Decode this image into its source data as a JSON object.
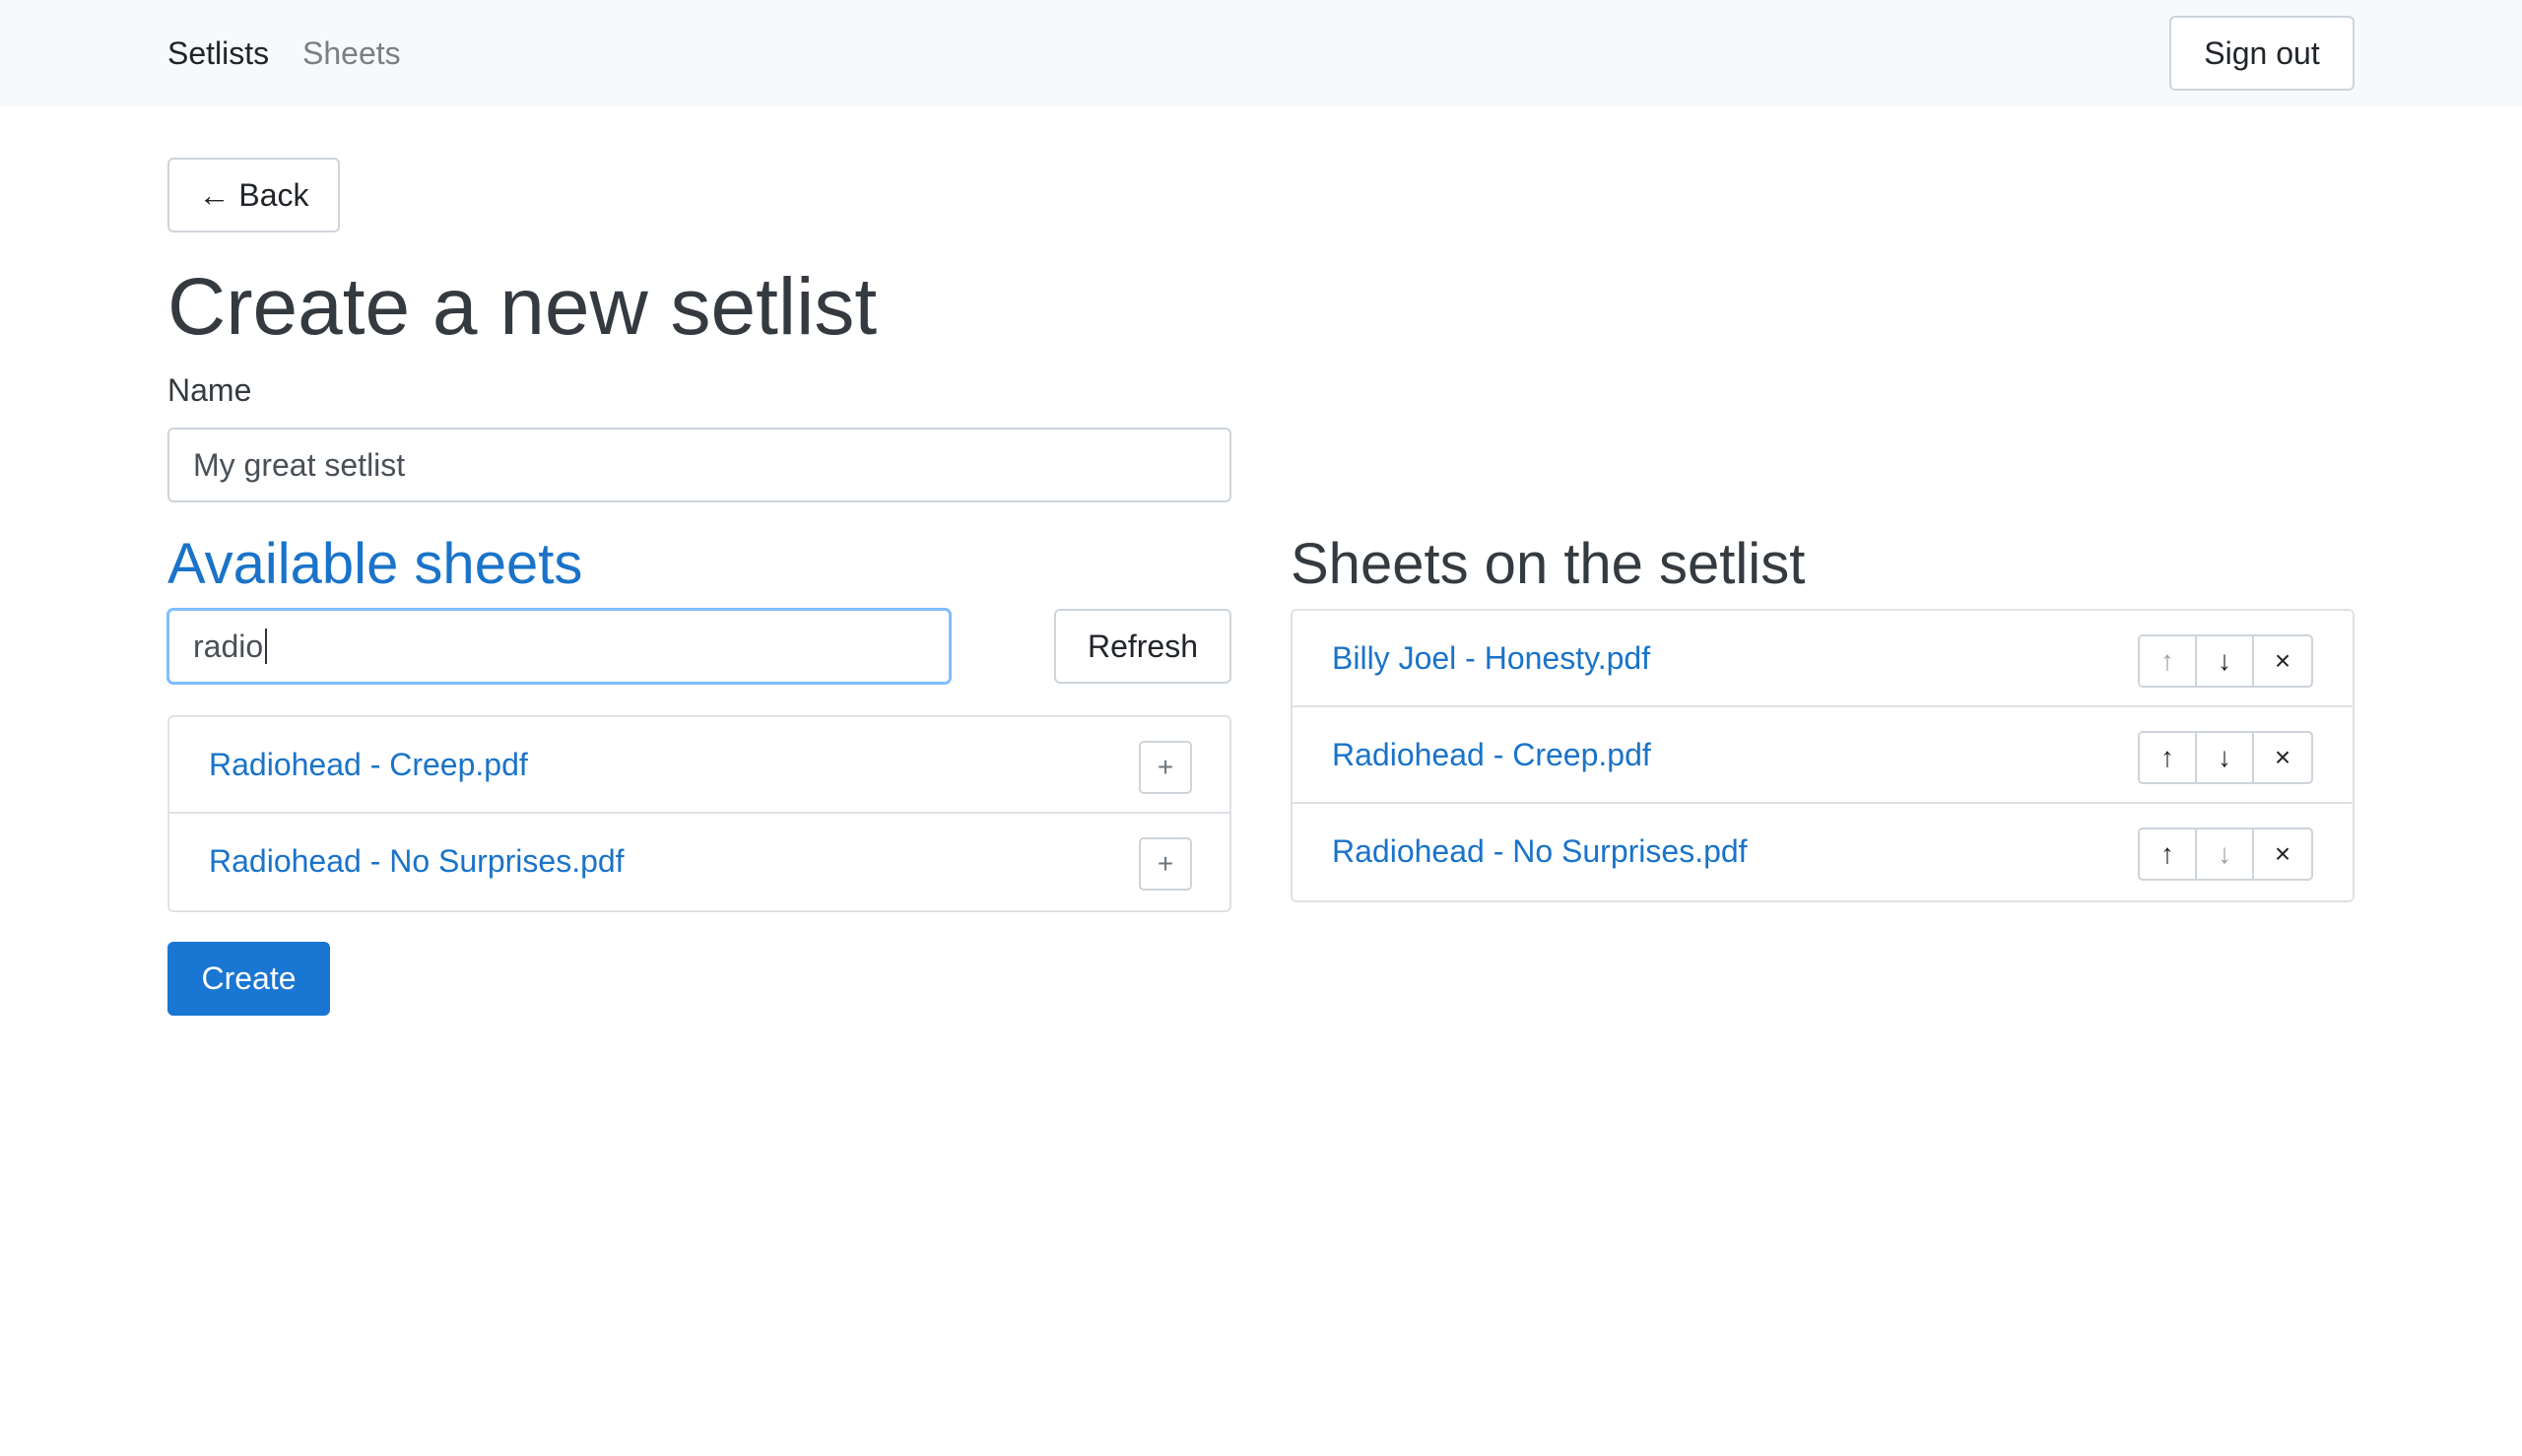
{
  "nav": {
    "links": [
      "Setlists",
      "Sheets"
    ],
    "sign_out": "Sign out"
  },
  "back_button": "← Back",
  "page_title": "Create a new setlist",
  "name_field": {
    "label": "Name",
    "value": "My great setlist"
  },
  "available": {
    "heading": "Available sheets",
    "search_value": "radio",
    "refresh_label": "Refresh",
    "items": [
      "Radiohead - Creep.pdf",
      "Radiohead - No Surprises.pdf"
    ],
    "add_symbol": "+"
  },
  "setlist": {
    "heading": "Sheets on the setlist",
    "items": [
      "Billy Joel - Honesty.pdf",
      "Radiohead - Creep.pdf",
      "Radiohead - No Surprises.pdf"
    ],
    "up_symbol": "↑",
    "down_symbol": "↓",
    "remove_symbol": "×"
  },
  "create_button": "Create",
  "colors": {
    "primary": "#1976d2",
    "link": "#1a73c9",
    "navbar_bg": "#f8f9fa"
  }
}
